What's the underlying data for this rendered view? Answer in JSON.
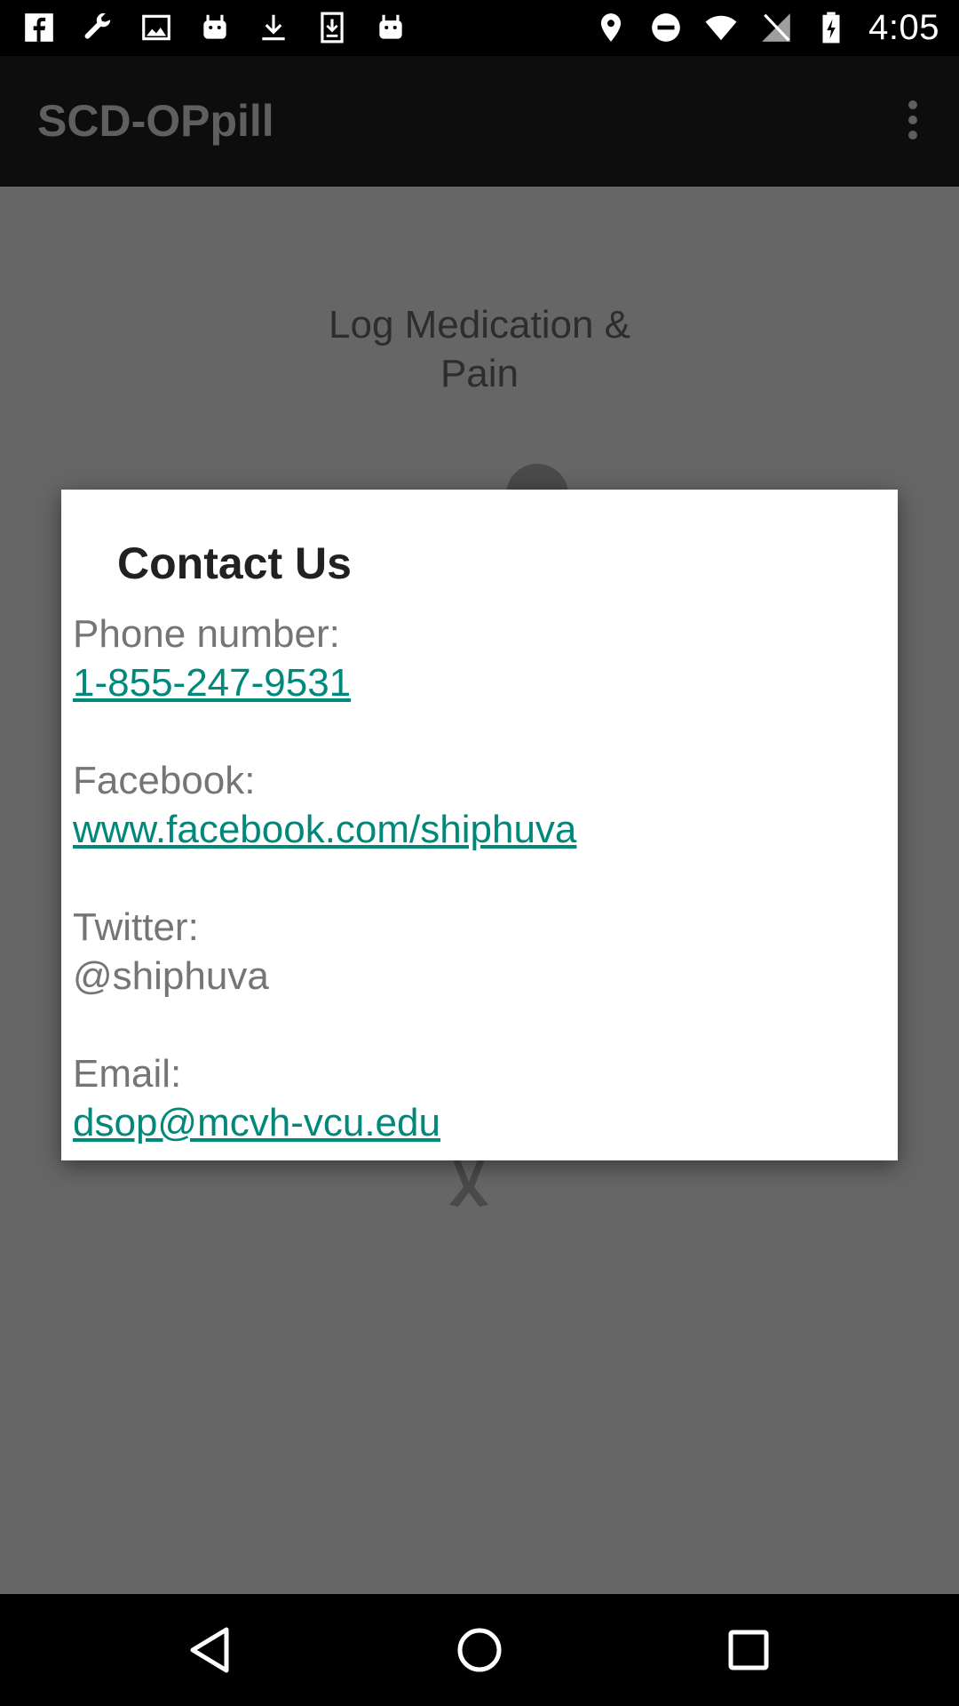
{
  "status_bar": {
    "time": "4:05",
    "left_icons": [
      "facebook-icon",
      "wrench-icon",
      "image-icon",
      "android-icon",
      "download-icon",
      "download-box-icon",
      "android-icon"
    ],
    "right_icons": [
      "location-icon",
      "do-not-disturb-icon",
      "wifi-icon",
      "no-signal-icon",
      "battery-charging-icon"
    ]
  },
  "app_bar": {
    "title": "SCD-OPpill",
    "menu_icon": "overflow-menu-icon"
  },
  "main": {
    "heading_line1": "Log Medication &",
    "heading_line2": "Pain"
  },
  "dialog": {
    "title": "Contact Us",
    "phone_label": "Phone number:",
    "phone_value": "1-855-247-9531",
    "facebook_label": "Facebook:",
    "facebook_value": "www.facebook.com/shiphuva",
    "twitter_label": "Twitter:",
    "twitter_value": "@shiphuva",
    "email_label": "Email:",
    "email_value": "dsop@mcvh-vcu.edu"
  },
  "nav_bar": {
    "back": "back-icon",
    "home": "home-icon",
    "recents": "recents-icon"
  },
  "colors": {
    "link": "#00897b",
    "scrim": "#666666",
    "dialog_bg": "#ffffff",
    "text_secondary": "#757575"
  }
}
